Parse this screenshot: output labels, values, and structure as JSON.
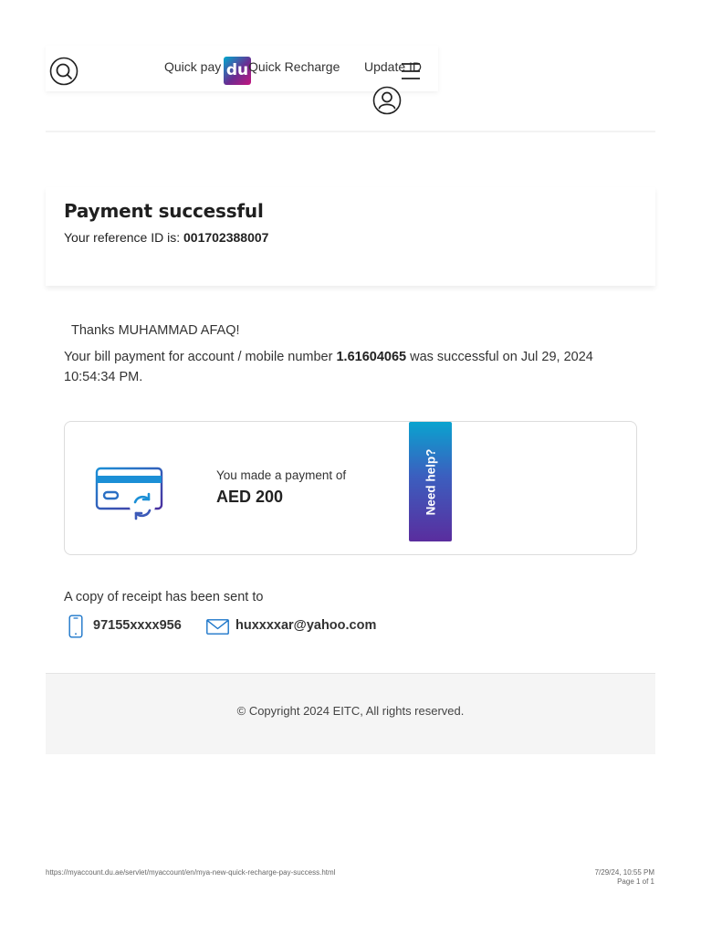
{
  "header": {
    "nav": {
      "quick_pay": "Quick pay",
      "quick_recharge": "Quick Recharge",
      "update_id": "Update ID"
    },
    "logo_text": "du",
    "icons": [
      "search-icon",
      "menu-icon",
      "user-icon"
    ]
  },
  "success": {
    "title": "Payment successful",
    "reference_label": "Your reference ID is: ",
    "reference_id": "001702388007"
  },
  "message": {
    "thanks": "Thanks MUHAMMAD AFAQ!",
    "bill_prefix": "Your bill payment for account / mobile number ",
    "account_number": "1.61604065",
    "bill_suffix": " was successful on Jul 29, 2024 10:54:34 PM."
  },
  "payment": {
    "label": "You made a payment of",
    "amount": "AED 200",
    "icon": "card-refresh-icon"
  },
  "help_tab": {
    "label": "Need help?"
  },
  "receipt": {
    "label": "A copy of receipt has been sent to",
    "phone": "97155xxxx956",
    "email": "huxxxxar@yahoo.com"
  },
  "footer": {
    "copyright": "© Copyright 2024 EITC, All rights reserved."
  },
  "print": {
    "url": "https://myaccount.du.ae/servlet/myaccount/en/mya-new-quick-recharge-pay-success.html",
    "datetime": "7/29/24, 10:55 PM",
    "page": "Page 1 of 1"
  },
  "colors": {
    "brand_blue": "#1b75c9",
    "brand_purple": "#6a2c91",
    "help_gradient_top": "#0aa3cf",
    "help_gradient_bottom": "#5a2d9e"
  }
}
